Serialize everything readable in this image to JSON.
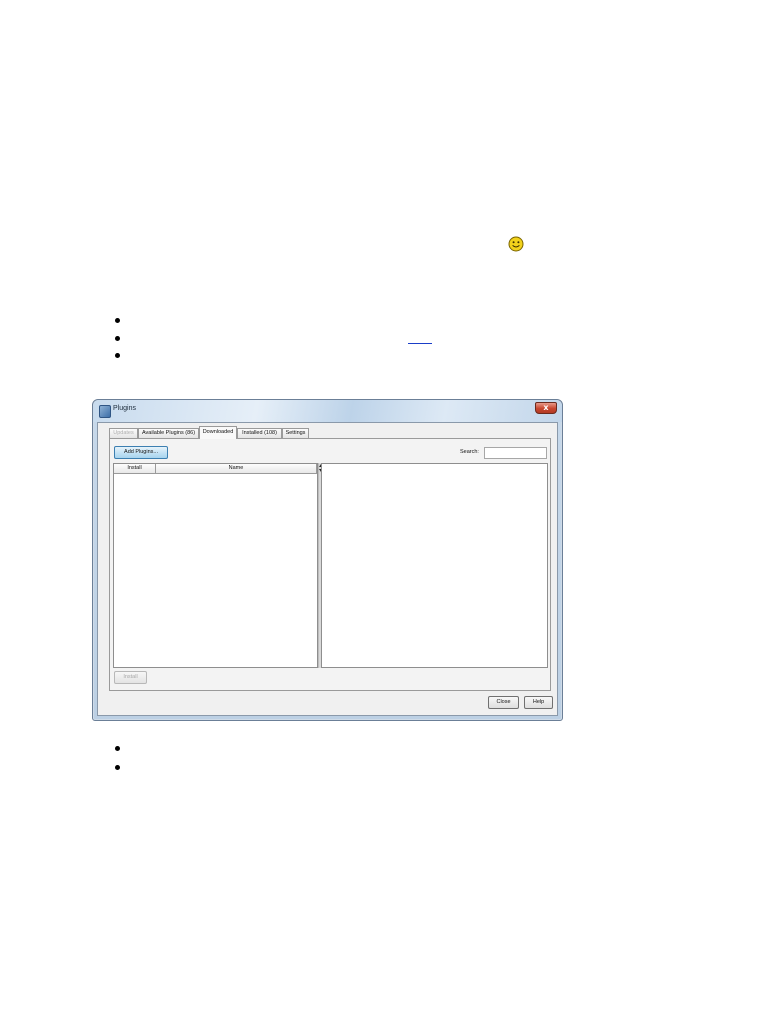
{
  "window": {
    "title": "Plugins",
    "close_glyph": "x"
  },
  "tabs": [
    {
      "label": "Updates",
      "state": "disabled"
    },
    {
      "label": "Available Plugins (86)",
      "state": "normal"
    },
    {
      "label": "Downloaded",
      "state": "active"
    },
    {
      "label": "Installed (108)",
      "state": "normal"
    },
    {
      "label": "Settings",
      "state": "normal"
    }
  ],
  "toolbar": {
    "add_plugins_label": "Add Plugins...",
    "search_label": "Search:",
    "search_value": ""
  },
  "table": {
    "columns": [
      "Install",
      "Name"
    ],
    "rows": []
  },
  "actions": {
    "install_label": "Install",
    "close_label": "Close",
    "help_label": "Help"
  },
  "colors": {
    "accent_button": "#a9d4ee",
    "titlebar": "#c8dbee",
    "close_button": "#c8462f",
    "smiley": "#f2d21c"
  },
  "icons": {
    "page_smiley": "smiley-icon",
    "window_icon": "plugins-window-icon"
  }
}
